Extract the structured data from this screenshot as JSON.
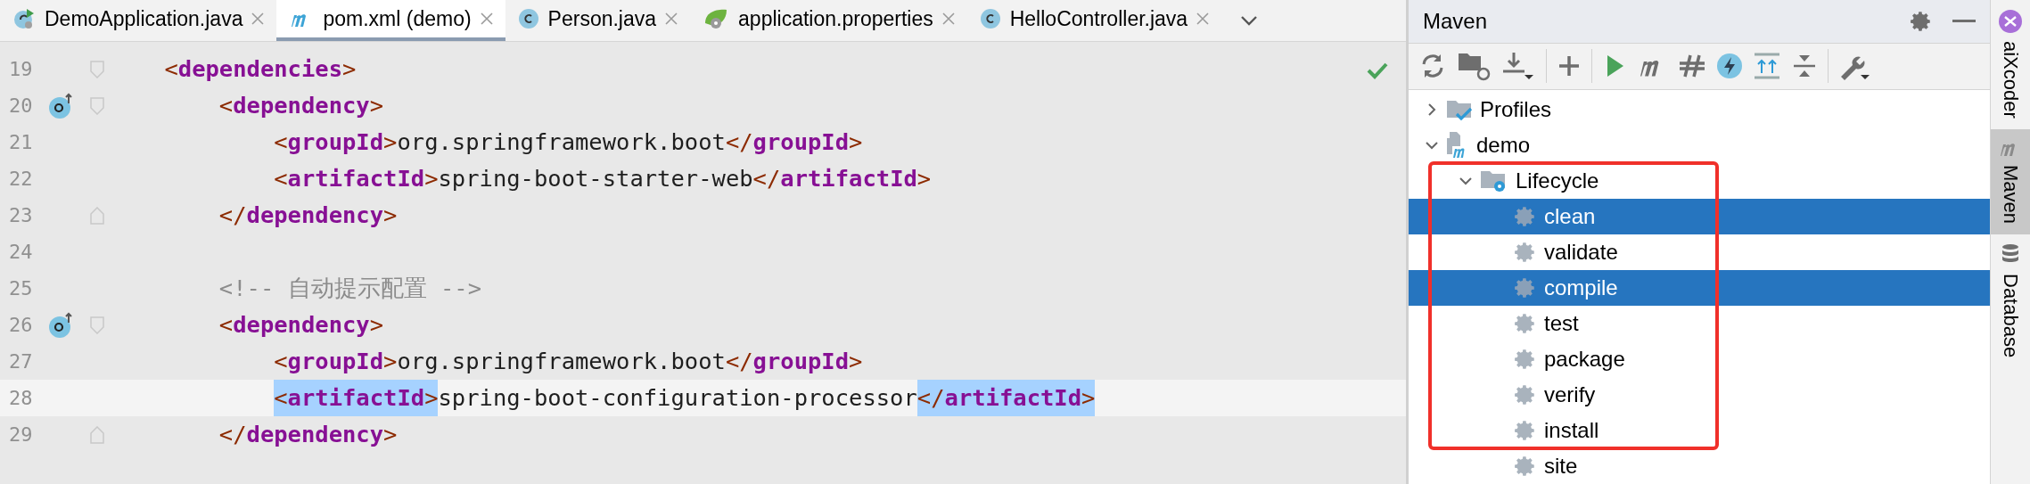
{
  "tabs": [
    {
      "label": "DemoApplication.java",
      "kind": "app-class",
      "selected": false
    },
    {
      "label": "pom.xml (demo)",
      "kind": "maven",
      "selected": true
    },
    {
      "label": "Person.java",
      "kind": "class",
      "selected": false
    },
    {
      "label": "application.properties",
      "kind": "spring",
      "selected": false
    },
    {
      "label": "HelloController.java",
      "kind": "class",
      "selected": false
    }
  ],
  "editor": {
    "lines": [
      {
        "number": "19",
        "fold_start": true,
        "fold_end": false,
        "override_marker": false,
        "current": false,
        "segments": [
          {
            "kind": "tag",
            "text": "    <dependencies>",
            "selected": false
          }
        ]
      },
      {
        "number": "20",
        "fold_start": true,
        "fold_end": false,
        "override_marker": true,
        "current": false,
        "segments": [
          {
            "kind": "tag",
            "text": "        <dependency>",
            "selected": false
          }
        ]
      },
      {
        "number": "21",
        "fold_start": false,
        "fold_end": false,
        "override_marker": false,
        "current": false,
        "segments": [
          {
            "kind": "tag",
            "text": "            <groupId>",
            "selected": false
          },
          {
            "kind": "plain",
            "text": "org.springframework.boot"
          },
          {
            "kind": "tag",
            "text": "</groupId>",
            "selected": false
          }
        ]
      },
      {
        "number": "22",
        "fold_start": false,
        "fold_end": false,
        "override_marker": false,
        "current": false,
        "segments": [
          {
            "kind": "tag",
            "text": "            <artifactId>",
            "selected": false
          },
          {
            "kind": "plain",
            "text": "spring-boot-starter-web"
          },
          {
            "kind": "tag",
            "text": "</artifactId>",
            "selected": false
          }
        ]
      },
      {
        "number": "23",
        "fold_start": false,
        "fold_end": true,
        "override_marker": false,
        "current": false,
        "segments": [
          {
            "kind": "tag",
            "text": "        </dependency>",
            "selected": false
          }
        ]
      },
      {
        "number": "24",
        "fold_start": false,
        "fold_end": false,
        "override_marker": false,
        "current": false
      },
      {
        "number": "25",
        "fold_start": false,
        "fold_end": false,
        "override_marker": false,
        "current": false,
        "segments": [
          {
            "kind": "comment",
            "text": "        <!-- 自动提示配置 -->"
          }
        ]
      },
      {
        "number": "26",
        "fold_start": true,
        "fold_end": false,
        "override_marker": true,
        "current": false,
        "segments": [
          {
            "kind": "tag",
            "text": "        <dependency>",
            "selected": false
          }
        ]
      },
      {
        "number": "27",
        "fold_start": false,
        "fold_end": false,
        "override_marker": false,
        "current": false,
        "segments": [
          {
            "kind": "tag",
            "text": "            <groupId>",
            "selected": false
          },
          {
            "kind": "plain",
            "text": "org.springframework.boot"
          },
          {
            "kind": "tag",
            "text": "</groupId>",
            "selected": false
          }
        ]
      },
      {
        "number": "28",
        "fold_start": false,
        "fold_end": false,
        "override_marker": false,
        "current": true,
        "segments": [
          {
            "kind": "tag",
            "text": "            <artifactId>",
            "selected": true
          },
          {
            "kind": "plain",
            "text": "spring-boot-configuration-processor"
          },
          {
            "kind": "tag",
            "text": "</artifactId>",
            "selected": true
          }
        ]
      },
      {
        "number": "29",
        "fold_start": false,
        "fold_end": true,
        "override_marker": false,
        "current": false,
        "segments": [
          {
            "kind": "tag",
            "text": "        </dependency>",
            "selected": false
          }
        ]
      }
    ]
  },
  "maven": {
    "title": "Maven",
    "tree": [
      {
        "label": "Profiles",
        "kind": "profiles",
        "expanded": false
      },
      {
        "label": "demo",
        "kind": "project",
        "expanded": true,
        "children": [
          {
            "label": "Lifecycle",
            "kind": "folder",
            "expanded": true,
            "children": [
              {
                "label": "clean",
                "kind": "goal",
                "selected": true
              },
              {
                "label": "validate",
                "kind": "goal",
                "selected": false
              },
              {
                "label": "compile",
                "kind": "goal",
                "selected": true
              },
              {
                "label": "test",
                "kind": "goal",
                "selected": false
              },
              {
                "label": "package",
                "kind": "goal",
                "selected": false
              },
              {
                "label": "verify",
                "kind": "goal",
                "selected": false
              },
              {
                "label": "install",
                "kind": "goal",
                "selected": false
              },
              {
                "label": "site",
                "kind": "goal",
                "selected": false
              }
            ]
          }
        ]
      }
    ]
  },
  "side_tabs": [
    {
      "label": "aiXcoder",
      "kind": "aix",
      "selected": false
    },
    {
      "label": "Maven",
      "kind": "maven",
      "selected": true
    },
    {
      "label": "Database",
      "kind": "database",
      "selected": false
    }
  ]
}
